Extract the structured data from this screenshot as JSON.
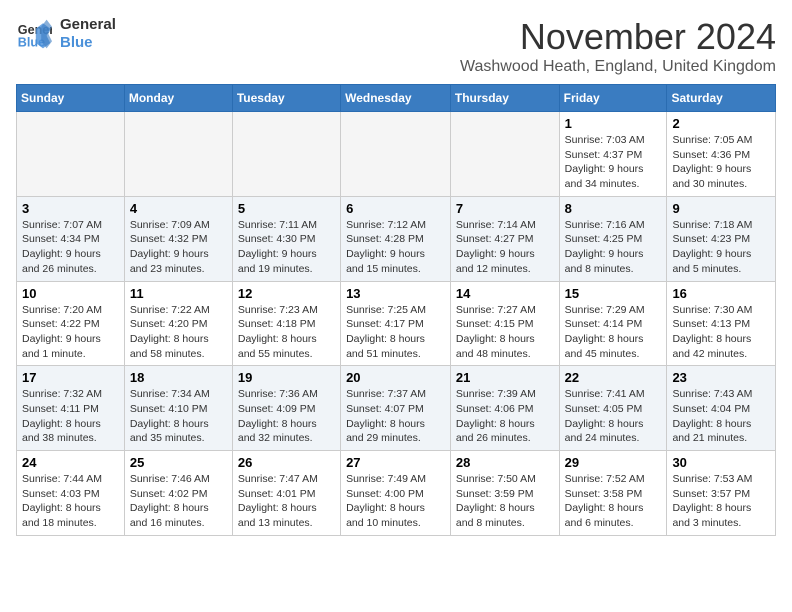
{
  "logo": {
    "line1": "General",
    "line2": "Blue"
  },
  "title": "November 2024",
  "location": "Washwood Heath, England, United Kingdom",
  "days_of_week": [
    "Sunday",
    "Monday",
    "Tuesday",
    "Wednesday",
    "Thursday",
    "Friday",
    "Saturday"
  ],
  "weeks": [
    [
      {
        "day": "",
        "info": ""
      },
      {
        "day": "",
        "info": ""
      },
      {
        "day": "",
        "info": ""
      },
      {
        "day": "",
        "info": ""
      },
      {
        "day": "",
        "info": ""
      },
      {
        "day": "1",
        "info": "Sunrise: 7:03 AM\nSunset: 4:37 PM\nDaylight: 9 hours and 34 minutes."
      },
      {
        "day": "2",
        "info": "Sunrise: 7:05 AM\nSunset: 4:36 PM\nDaylight: 9 hours and 30 minutes."
      }
    ],
    [
      {
        "day": "3",
        "info": "Sunrise: 7:07 AM\nSunset: 4:34 PM\nDaylight: 9 hours and 26 minutes."
      },
      {
        "day": "4",
        "info": "Sunrise: 7:09 AM\nSunset: 4:32 PM\nDaylight: 9 hours and 23 minutes."
      },
      {
        "day": "5",
        "info": "Sunrise: 7:11 AM\nSunset: 4:30 PM\nDaylight: 9 hours and 19 minutes."
      },
      {
        "day": "6",
        "info": "Sunrise: 7:12 AM\nSunset: 4:28 PM\nDaylight: 9 hours and 15 minutes."
      },
      {
        "day": "7",
        "info": "Sunrise: 7:14 AM\nSunset: 4:27 PM\nDaylight: 9 hours and 12 minutes."
      },
      {
        "day": "8",
        "info": "Sunrise: 7:16 AM\nSunset: 4:25 PM\nDaylight: 9 hours and 8 minutes."
      },
      {
        "day": "9",
        "info": "Sunrise: 7:18 AM\nSunset: 4:23 PM\nDaylight: 9 hours and 5 minutes."
      }
    ],
    [
      {
        "day": "10",
        "info": "Sunrise: 7:20 AM\nSunset: 4:22 PM\nDaylight: 9 hours and 1 minute."
      },
      {
        "day": "11",
        "info": "Sunrise: 7:22 AM\nSunset: 4:20 PM\nDaylight: 8 hours and 58 minutes."
      },
      {
        "day": "12",
        "info": "Sunrise: 7:23 AM\nSunset: 4:18 PM\nDaylight: 8 hours and 55 minutes."
      },
      {
        "day": "13",
        "info": "Sunrise: 7:25 AM\nSunset: 4:17 PM\nDaylight: 8 hours and 51 minutes."
      },
      {
        "day": "14",
        "info": "Sunrise: 7:27 AM\nSunset: 4:15 PM\nDaylight: 8 hours and 48 minutes."
      },
      {
        "day": "15",
        "info": "Sunrise: 7:29 AM\nSunset: 4:14 PM\nDaylight: 8 hours and 45 minutes."
      },
      {
        "day": "16",
        "info": "Sunrise: 7:30 AM\nSunset: 4:13 PM\nDaylight: 8 hours and 42 minutes."
      }
    ],
    [
      {
        "day": "17",
        "info": "Sunrise: 7:32 AM\nSunset: 4:11 PM\nDaylight: 8 hours and 38 minutes."
      },
      {
        "day": "18",
        "info": "Sunrise: 7:34 AM\nSunset: 4:10 PM\nDaylight: 8 hours and 35 minutes."
      },
      {
        "day": "19",
        "info": "Sunrise: 7:36 AM\nSunset: 4:09 PM\nDaylight: 8 hours and 32 minutes."
      },
      {
        "day": "20",
        "info": "Sunrise: 7:37 AM\nSunset: 4:07 PM\nDaylight: 8 hours and 29 minutes."
      },
      {
        "day": "21",
        "info": "Sunrise: 7:39 AM\nSunset: 4:06 PM\nDaylight: 8 hours and 26 minutes."
      },
      {
        "day": "22",
        "info": "Sunrise: 7:41 AM\nSunset: 4:05 PM\nDaylight: 8 hours and 24 minutes."
      },
      {
        "day": "23",
        "info": "Sunrise: 7:43 AM\nSunset: 4:04 PM\nDaylight: 8 hours and 21 minutes."
      }
    ],
    [
      {
        "day": "24",
        "info": "Sunrise: 7:44 AM\nSunset: 4:03 PM\nDaylight: 8 hours and 18 minutes."
      },
      {
        "day": "25",
        "info": "Sunrise: 7:46 AM\nSunset: 4:02 PM\nDaylight: 8 hours and 16 minutes."
      },
      {
        "day": "26",
        "info": "Sunrise: 7:47 AM\nSunset: 4:01 PM\nDaylight: 8 hours and 13 minutes."
      },
      {
        "day": "27",
        "info": "Sunrise: 7:49 AM\nSunset: 4:00 PM\nDaylight: 8 hours and 10 minutes."
      },
      {
        "day": "28",
        "info": "Sunrise: 7:50 AM\nSunset: 3:59 PM\nDaylight: 8 hours and 8 minutes."
      },
      {
        "day": "29",
        "info": "Sunrise: 7:52 AM\nSunset: 3:58 PM\nDaylight: 8 hours and 6 minutes."
      },
      {
        "day": "30",
        "info": "Sunrise: 7:53 AM\nSunset: 3:57 PM\nDaylight: 8 hours and 3 minutes."
      }
    ]
  ]
}
